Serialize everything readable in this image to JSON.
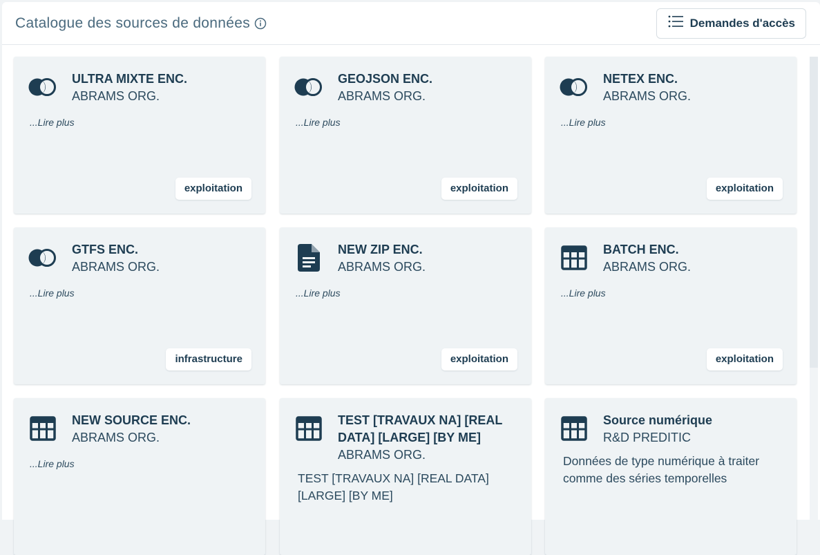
{
  "header": {
    "title": "Catalogue des sources de données",
    "info_icon": "info-circle-icon",
    "access_button": {
      "label": "Demandes d'accès",
      "icon": "list-icon"
    }
  },
  "cards": [
    {
      "title": "ULTRA MIXTE ENC.",
      "org": "ABRAMS ORG.",
      "description": "...Lire plus",
      "tag": "exploitation",
      "icon": "mixed-source-icon"
    },
    {
      "title": "GEOJSON ENC.",
      "org": "ABRAMS ORG.",
      "description": "...Lire plus",
      "tag": "exploitation",
      "icon": "mixed-source-icon"
    },
    {
      "title": "NETEX ENC.",
      "org": "ABRAMS ORG.",
      "description": "...Lire plus",
      "tag": "exploitation",
      "icon": "mixed-source-icon"
    },
    {
      "title": "GTFS ENC.",
      "org": "ABRAMS ORG.",
      "description": "...Lire plus",
      "tag": "infrastructure",
      "icon": "mixed-source-icon"
    },
    {
      "title": "NEW ZIP ENC.",
      "org": "ABRAMS ORG.",
      "description": "...Lire plus",
      "tag": "exploitation",
      "icon": "file-icon"
    },
    {
      "title": "BATCH ENC.",
      "org": "ABRAMS ORG.",
      "description": "...Lire plus",
      "tag": "exploitation",
      "icon": "table-icon"
    },
    {
      "title": "NEW SOURCE ENC.",
      "org": "ABRAMS ORG.",
      "description": "...Lire plus",
      "icon": "table-icon"
    },
    {
      "title": "TEST [TRAVAUX NA] [REAL DATA] [LARGE] [BY ME]",
      "org": "ABRAMS ORG.",
      "description": "TEST [TRAVAUX NA] [REAL DATA] [LARGE] [BY ME]",
      "icon": "table-icon"
    },
    {
      "title": "Source numérique",
      "org": "R&D PREDITIC",
      "description": "Données de type numérique à traiter comme des séries temporelles",
      "icon": "table-icon"
    }
  ],
  "colors": {
    "primary": "#1e3d52",
    "card_bg": "#eff3f5",
    "title_gray": "#4a6a7e"
  }
}
